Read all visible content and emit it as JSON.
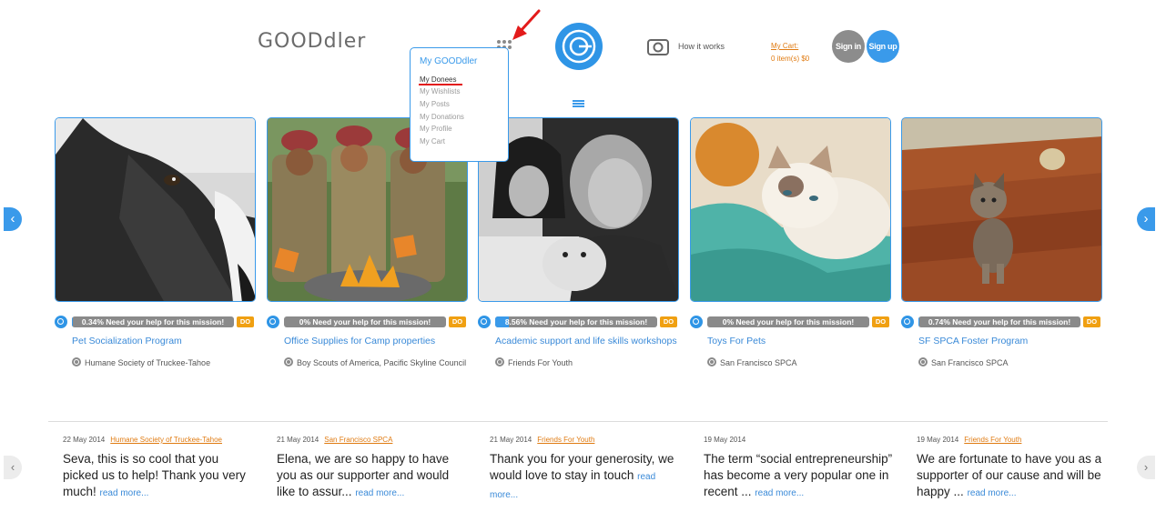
{
  "header": {
    "logo": "GOODdler",
    "how_it_works": "How it works",
    "cart_label": "My Cart:",
    "cart_items": "0 item(s) $0",
    "sign_in": "Sign in",
    "sign_up": "Sign up"
  },
  "dropdown": {
    "title": "My GOODdler",
    "items": [
      "My Donees",
      "My Wishlists",
      "My Posts",
      "My Donations",
      "My Profile",
      "My Cart"
    ]
  },
  "do_label": "DO",
  "cards": [
    {
      "progress_text": "0.34% Need your help for this mission!",
      "progress": 0.0034,
      "title": "Pet Socialization Program",
      "org": "Humane Society of Truckee-Tahoe"
    },
    {
      "progress_text": "0% Need your help for this mission!",
      "progress": 0.0,
      "title": "Office Supplies for Camp properties",
      "org": "Boy Scouts of America, Pacific Skyline Council"
    },
    {
      "progress_text": "8.56% Need your help for this mission!",
      "progress": 0.0856,
      "title": "Academic support and life skills workshops",
      "org": "Friends For Youth"
    },
    {
      "progress_text": "0% Need your help for this mission!",
      "progress": 0.0,
      "title": "Toys For Pets",
      "org": "San Francisco SPCA"
    },
    {
      "progress_text": "0.74% Need your help for this mission!",
      "progress": 0.0074,
      "title": "SF SPCA Foster Program",
      "org": "San Francisco SPCA"
    }
  ],
  "testimonials": [
    {
      "date": "22 May 2014",
      "org": "Humane Society of Truckee-Tahoe",
      "text": "Seva, this is so cool that you picked us to help! Thank you very much!",
      "more": "read more..."
    },
    {
      "date": "21 May 2014",
      "org": "San Francisco SPCA",
      "text": "Elena, we are so happy to have you as our supporter and would like to assur...",
      "more": "read more..."
    },
    {
      "date": "21 May 2014",
      "org": "Friends For Youth",
      "text": "Thank you for your generosity, we would love to stay in touch",
      "more": "read more..."
    },
    {
      "date": "19 May 2014",
      "org": "",
      "text": "The term “social entrepreneurship” has become a very popular one in recent ...",
      "more": "read more..."
    },
    {
      "date": "19 May 2014",
      "org": "Friends For Youth",
      "text": "We are fortunate to have you as a supporter of our cause and will be happy ...",
      "more": "read more..."
    }
  ],
  "colors": {
    "accent": "#3a9aea",
    "orange": "#e07b12",
    "badge": "#f0a012",
    "annotation": "#e31b1b"
  },
  "icons": [
    "apps-grid-icon",
    "gooddler-logo-icon",
    "how-it-works-icon",
    "chevron-left-icon",
    "chevron-right-icon",
    "menu-icon"
  ]
}
